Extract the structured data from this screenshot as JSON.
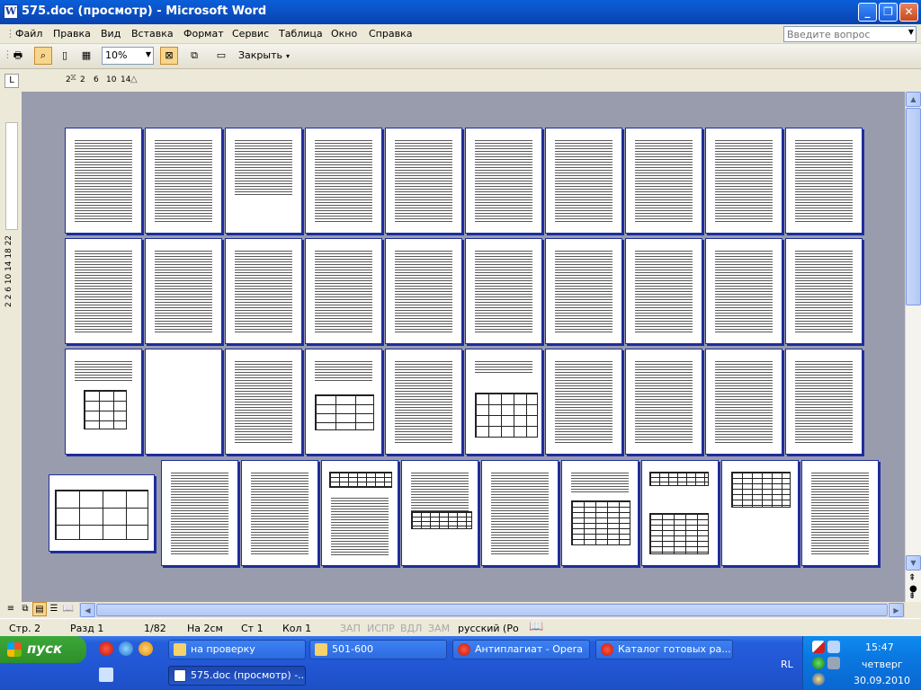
{
  "window": {
    "title": "575.doc (просмотр) - Microsoft Word",
    "app_icon": "W",
    "controls": {
      "minimize": "_",
      "restore": "❐",
      "close": "✕"
    }
  },
  "menu": {
    "items": [
      "Файл",
      "Правка",
      "Вид",
      "Вставка",
      "Формат",
      "Сервис",
      "Таблица",
      "Окно",
      "Справка"
    ],
    "help_placeholder": "Введите вопрос"
  },
  "toolbar": {
    "zoom": "10%",
    "close_label": "Закрыть",
    "icons": [
      "print-icon",
      "magnifier-icon",
      "one-page-icon",
      "multiple-pages-icon",
      "shrink-to-fit-icon",
      "full-screen-icon",
      "view-ruler-icon"
    ]
  },
  "ruler": {
    "ticks": [
      "2",
      "2",
      "6",
      "10",
      "14"
    ],
    "vertical_ticks": "2 2 6 10 14 18 22"
  },
  "pages": {
    "rows": [
      [
        "text",
        "text",
        "text",
        "text",
        "text",
        "text",
        "text",
        "text",
        "text",
        "text"
      ],
      [
        "text",
        "text",
        "text",
        "text",
        "text",
        "text",
        "text",
        "text",
        "text",
        "text"
      ],
      [
        "diagram",
        "blank",
        "text",
        "diagram",
        "text",
        "diagram",
        "text",
        "text",
        "text",
        "text"
      ],
      [
        "landscape-table",
        "text",
        "text",
        "table",
        "text",
        "text",
        "table",
        "table",
        "table",
        "text",
        "text"
      ]
    ]
  },
  "status": {
    "page": "Стр. 2",
    "section": "Разд 1",
    "pages": "1/82",
    "at": "На 2см",
    "line": "Ст 1",
    "column": "Кол 1",
    "rec": "ЗАП",
    "trk": "ИСПР",
    "ext": "ВДЛ",
    "ovr": "ЗАМ",
    "language": "русский (Ро"
  },
  "taskbar": {
    "start_label": "пуск",
    "tasks": [
      {
        "label": "на проверку",
        "icon": "folder-icon"
      },
      {
        "label": "501-600",
        "icon": "folder-icon"
      },
      {
        "label": "Антиплагиат - Opera",
        "icon": "opera-icon"
      },
      {
        "label": "Каталог готовых ра...",
        "icon": "opera-icon"
      },
      {
        "label": "575.doc (просмотр) -...",
        "icon": "word-icon"
      }
    ],
    "language": "RL",
    "time": "15:47",
    "day": "четверг",
    "date": "30.09.2010"
  }
}
